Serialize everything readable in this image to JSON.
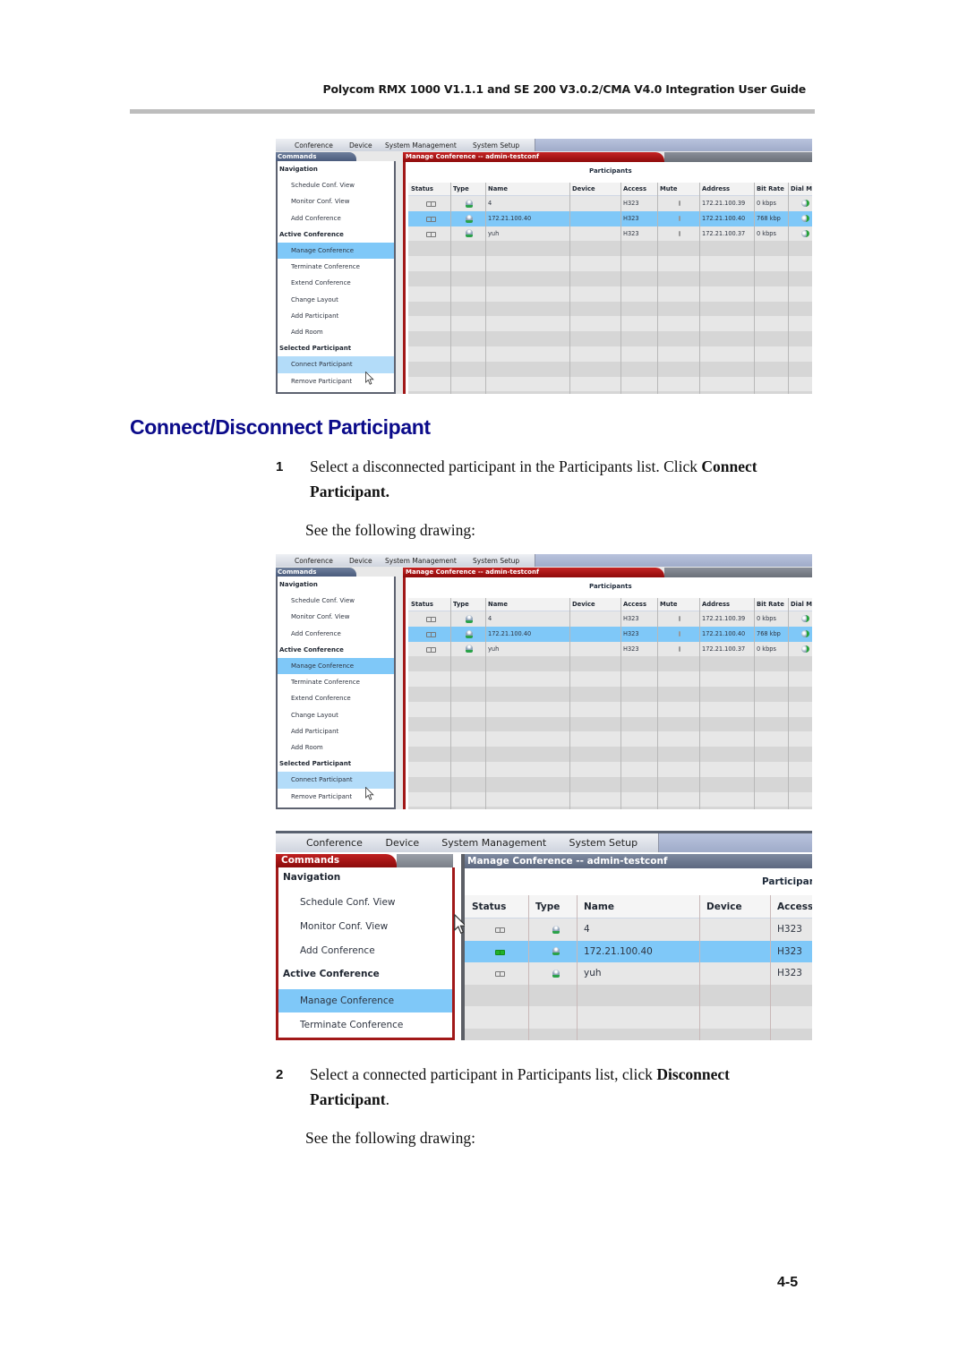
{
  "header": {
    "title": "Polycom RMX 1000 V1.1.1 and SE 200 V3.0.2/CMA V4.0 Integration User Guide"
  },
  "section": {
    "title": "Connect/Disconnect Participant"
  },
  "steps": [
    {
      "number": "1",
      "text_before": "Select a disconnected participant in the Participants list. Click ",
      "bold": "Connect",
      "text_line2_bold": "Participant.",
      "text_line2_after": "",
      "see": "See the following drawing:"
    },
    {
      "number": "2",
      "text_before": "Select a connected participant in Participants list, click ",
      "bold": "Disconnect",
      "text_line2_bold": "Participant",
      "text_line2_after": ".",
      "see": "See the following drawing:"
    }
  ],
  "page_number": "4-5",
  "app": {
    "menu": [
      "Conference",
      "Device",
      "System Management",
      "System Setup"
    ],
    "commands_tab": "Commands",
    "main_tab": "Manage Conference -- admin-testconf",
    "participants_title": "Participants",
    "commands": [
      {
        "label": "Navigation",
        "type": "head"
      },
      {
        "label": "Schedule Conf. View",
        "type": "item"
      },
      {
        "label": "Monitor Conf. View",
        "type": "item"
      },
      {
        "label": "Add Conference",
        "type": "item"
      },
      {
        "label": "Active Conference",
        "type": "head"
      },
      {
        "label": "Manage Conference",
        "type": "selected"
      },
      {
        "label": "Terminate Conference",
        "type": "item"
      },
      {
        "label": "Extend Conference",
        "type": "item"
      },
      {
        "label": "Change Layout",
        "type": "item"
      },
      {
        "label": "Add Participant",
        "type": "item"
      },
      {
        "label": "Add Room",
        "type": "item"
      },
      {
        "label": "Selected Participant",
        "type": "head"
      },
      {
        "label": "Connect Participant",
        "type": "hover"
      },
      {
        "label": "Remove Participant",
        "type": "item"
      }
    ],
    "columns": [
      "Status",
      "Type",
      "Name",
      "Device",
      "Access",
      "Mute",
      "Address",
      "Bit Rate",
      "Dial M"
    ],
    "rows": [
      {
        "status": "disconnected-icon",
        "type": "endpoint-icon",
        "name": "4",
        "device": "",
        "access": "H323",
        "mute": "mute-icon",
        "address": "172.21.100.39",
        "bitrate": "0 kbps",
        "dial": "dial-out-icon",
        "selected": false
      },
      {
        "status": "disconnected-icon",
        "type": "endpoint-icon",
        "name": "172.21.100.40",
        "device": "",
        "access": "H323",
        "mute": "mute-icon",
        "address": "172.21.100.40",
        "bitrate": "768 kbp",
        "dial": "dial-out-icon",
        "selected": true
      },
      {
        "status": "disconnected-icon",
        "type": "endpoint-icon",
        "name": "yuh",
        "device": "",
        "access": "H323",
        "mute": "mute-icon",
        "address": "172.21.100.37",
        "bitrate": "0 kbps",
        "dial": "dial-out-icon",
        "selected": false
      }
    ],
    "zoom_rows_status": [
      "disconnected",
      "connected",
      "disconnected"
    ]
  }
}
